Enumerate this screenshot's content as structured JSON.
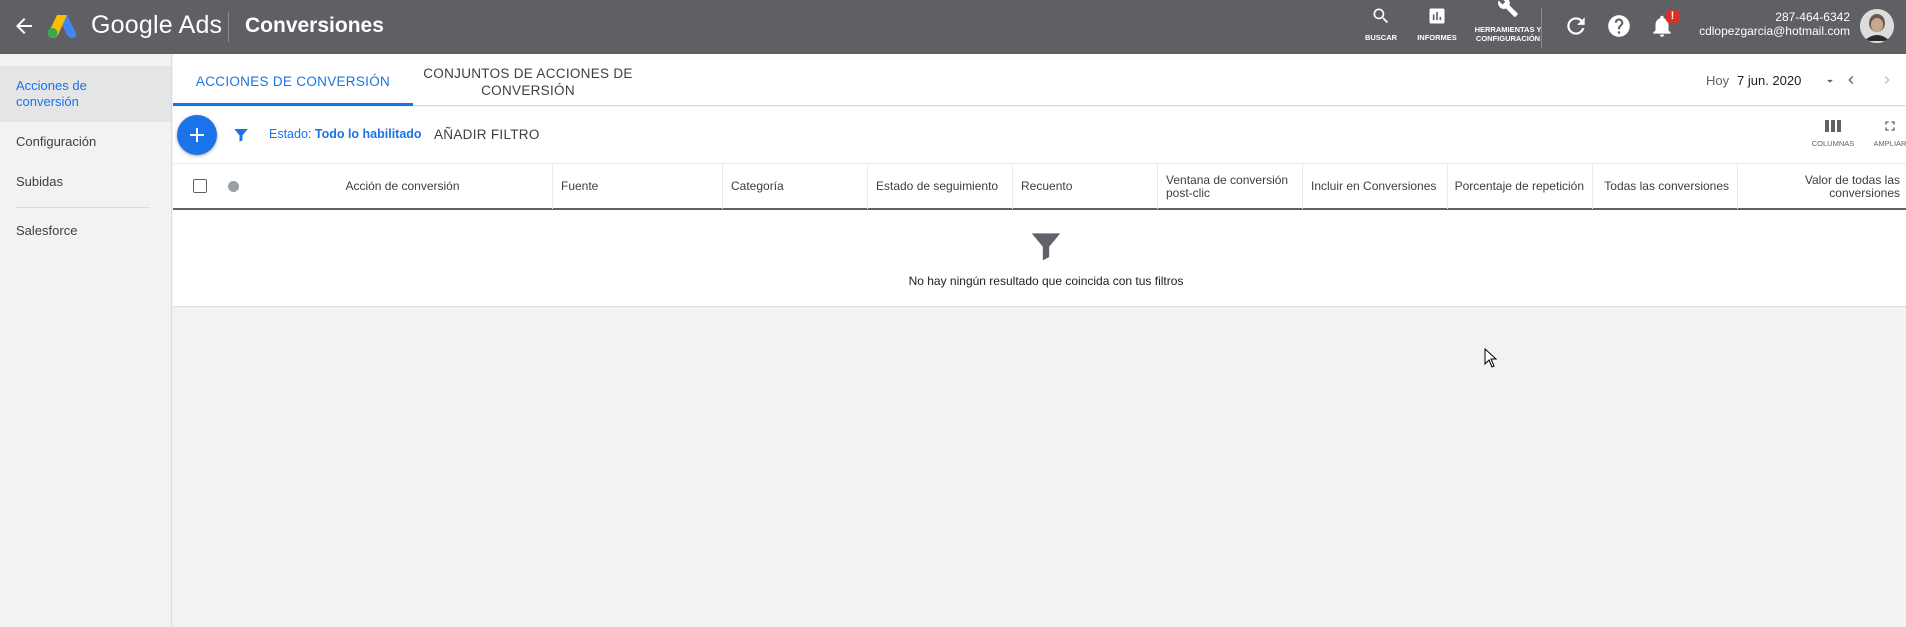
{
  "header": {
    "brand": "Google Ads",
    "page_title": "Conversiones",
    "tools": [
      {
        "label": "BUSCAR",
        "icon": "search-icon"
      },
      {
        "label": "INFORMES",
        "icon": "bar-chart-icon"
      },
      {
        "label": "HERRAMIENTAS Y CONFIGURACIÓN",
        "icon": "wrench-icon"
      }
    ],
    "notification_badge": "!",
    "account_id": "287-464-6342",
    "account_email": "cdlopezgarcia@hotmail.com"
  },
  "sidebar": {
    "items": [
      {
        "label": "Acciones de conversión",
        "active": true
      },
      {
        "label": "Configuración"
      },
      {
        "label": "Subidas"
      },
      {
        "label": "Salesforce"
      }
    ]
  },
  "tabs": [
    {
      "label": "ACCIONES DE CONVERSIÓN",
      "active": true
    },
    {
      "label": "CONJUNTOS DE ACCIONES DE CONVERSIÓN"
    }
  ],
  "date": {
    "label": "Hoy",
    "value": "7 jun. 2020"
  },
  "filter": {
    "estado_label": "Estado:",
    "estado_value": "Todo lo habilitado",
    "add_filter": "AÑADIR FILTRO"
  },
  "toolbar": {
    "columns": "COLUMNAS",
    "expand": "AMPLIAR"
  },
  "table": {
    "columns": [
      "Acción de conversión",
      "Fuente",
      "Categoría",
      "Estado de seguimiento",
      "Recuento",
      "Ventana de conversión post-clic",
      "Incluir en Conversiones",
      "Porcentaje de repetición",
      "Todas las conversiones",
      "Valor de todas las conversiones"
    ],
    "empty_message": "No hay ningún resultado que coincida con tus filtros"
  },
  "colors": {
    "header_bg": "#5f6063",
    "accent": "#1a73e8",
    "badge": "#d93025",
    "page_bg": "#f1f2f1"
  }
}
